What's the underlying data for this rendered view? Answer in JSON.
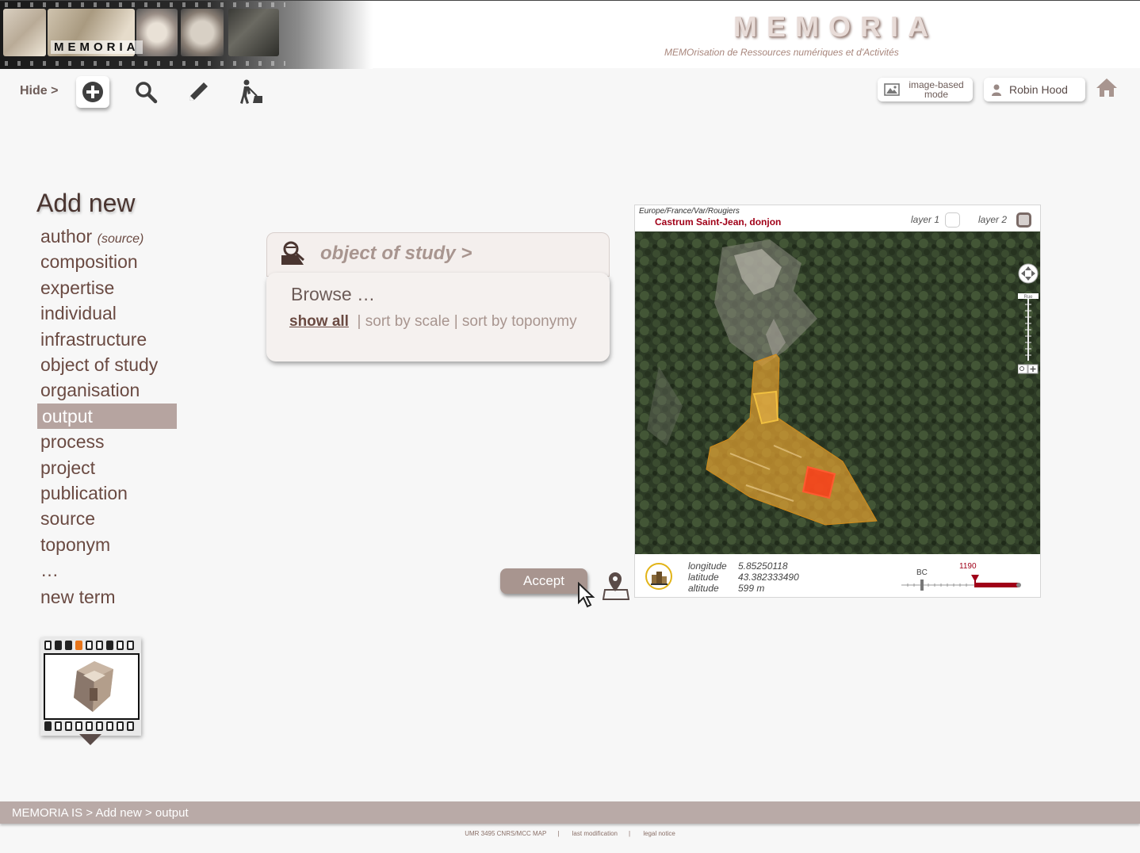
{
  "header": {
    "logo_text": "MEMORIA",
    "site_title": "MEMORIA",
    "site_subtitle": "MEMOrisation de Ressources numériques et d'Activités"
  },
  "toolbar": {
    "hide_label": "Hide >",
    "tools": [
      "add-icon",
      "search-icon",
      "pencil-icon",
      "worker-icon"
    ],
    "image_mode_label_1": "image-based",
    "image_mode_label_2": "mode",
    "user_name": "Robin Hood"
  },
  "menu": {
    "title": "Add new",
    "items": [
      {
        "label": "author",
        "note": "(source)"
      },
      {
        "label": "composition"
      },
      {
        "label": "expertise"
      },
      {
        "label": "individual"
      },
      {
        "label": "infrastructure"
      },
      {
        "label": "object of study"
      },
      {
        "label": "organisation"
      },
      {
        "label": "output",
        "selected": true
      },
      {
        "label": "process"
      },
      {
        "label": "project"
      },
      {
        "label": "publication"
      },
      {
        "label": "source"
      },
      {
        "label": "toponym"
      },
      {
        "label": "…"
      },
      {
        "label": "new term"
      }
    ]
  },
  "panel": {
    "title": "object of study >",
    "browse_title": "Browse …",
    "show_all": "show all",
    "sort_scale": "| sort by scale",
    "sort_toponymy": "| sort by toponymy",
    "accept_label": "Accept"
  },
  "map": {
    "path": "Europe/France/Var/Rougiers",
    "name": "Castrum Saint-Jean, donjon",
    "layer1_label": "layer 1",
    "layer2_label": "layer 2",
    "scale_label": "Rue",
    "longitude_label": "longitude",
    "longitude": "5.85250118",
    "latitude_label": "latitude",
    "latitude": "43.382333490",
    "altitude_label": "altitude",
    "altitude": "599 m",
    "timeline_start": "BC",
    "timeline_year": "1190",
    "colors": {
      "zone": "#e0a030",
      "selected": "#ff3b1a",
      "year": "#a00018"
    }
  },
  "footer": {
    "breadcrumb": "MEMORIA IS > Add new > output",
    "credit": "UMR 3495 CNRS/MCC MAP",
    "last_modification": "last modification",
    "legal_notice": "legal notice"
  }
}
